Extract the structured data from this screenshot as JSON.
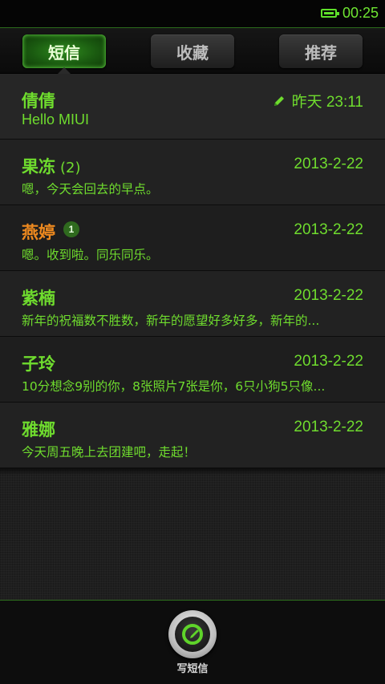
{
  "status_bar": {
    "time": "00:25"
  },
  "tabs": [
    {
      "label": "短信",
      "active": true
    },
    {
      "label": "收藏",
      "active": false
    },
    {
      "label": "推荐",
      "active": false
    }
  ],
  "threads": [
    {
      "name": "倩倩",
      "count": "",
      "unread": "",
      "time": "昨天 23:11",
      "draft": true,
      "preview": "Hello MIUI"
    },
    {
      "name": "果冻",
      "count": "(2)",
      "unread": "",
      "time": "2013-2-22",
      "draft": false,
      "preview": "嗯，今天会回去的早点。"
    },
    {
      "name": "燕婷",
      "count": "",
      "unread": "1",
      "time": "2013-2-22",
      "draft": false,
      "preview": "嗯。收到啦。同乐同乐。"
    },
    {
      "name": "紫楠",
      "count": "",
      "unread": "",
      "time": "2013-2-22",
      "draft": false,
      "preview": "新年的祝福数不胜数，新年的愿望好多好多，新年的..."
    },
    {
      "name": "子玲",
      "count": "",
      "unread": "",
      "time": "2013-2-22",
      "draft": false,
      "preview": "10分想念9别的你，8张照片7张是你，6只小狗5只像..."
    },
    {
      "name": "雅娜",
      "count": "",
      "unread": "",
      "time": "2013-2-22",
      "draft": false,
      "preview": "今天周五晚上去团建吧，走起！"
    }
  ],
  "compose": {
    "label": "写短信"
  },
  "colors": {
    "accent": "#6fdc2e",
    "unread_name": "#ef8a1f",
    "tab_active": "#2f8a1e"
  }
}
